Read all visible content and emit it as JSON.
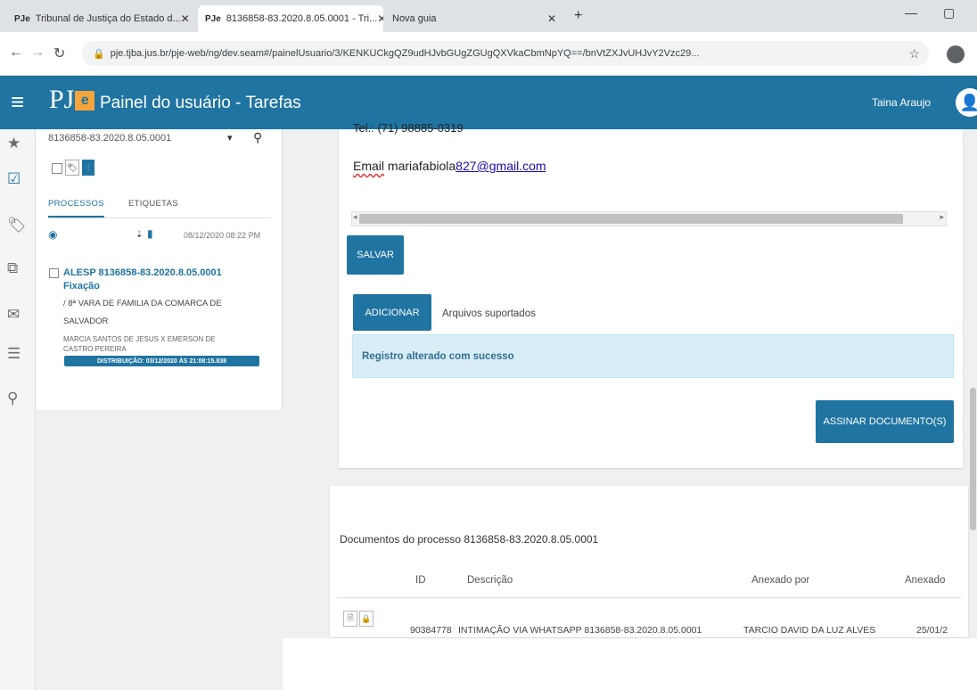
{
  "browser": {
    "tabs": [
      {
        "favicon": "PJe",
        "label": "Tribunal de Justiça do Estado d...",
        "active": false
      },
      {
        "favicon": "PJe",
        "label": "8136858-83.2020.8.05.0001 - Tri...",
        "active": true
      },
      {
        "favicon": "",
        "label": "Nova guia",
        "active": false
      }
    ],
    "url": "pje.tjba.jus.br/pje-web/ng/dev.seam#/painelUsuario/3/KENKUCkgQZ9udHJvbGUgZGUgQXVkaCbmNpYQ==/bnVtZXJvUHJvY2Vzc29...",
    "new_tab_glyph": "+"
  },
  "app": {
    "logo_text": "PJ",
    "logo_e": "e",
    "title": "Painel do usuário - Tarefas",
    "user_name": "Taina Araujo"
  },
  "sidebar": {
    "search_value": "8136858-83.2020.8.05.0001",
    "tabs": [
      "PROCESSOS",
      "ETIQUETAS"
    ],
    "list_date": "08/12/2020 08:22 PM",
    "process": {
      "number": "ALESP 8136858-83.2020.8.05.0001",
      "type": "Fixação",
      "org_line1": "/ 8ª VARA DE FAMILIA DA COMARCA DE",
      "org_line2": "SALVADOR",
      "parts_line1": "MARCIA SANTOS DE JESUS X EMERSON DE",
      "parts_line2": "CASTRO PEREIRA",
      "distribution": "DISTRIBUIÇÃO: 03/12/2020 ÀS 21:08:15.838"
    }
  },
  "editor": {
    "tel_line": "Tel.: (71) 98885-0319",
    "email_label": "Email",
    "email_prefix": " mariafabiola",
    "email_link": "827@gmail.com"
  },
  "actions": {
    "salvar": "SALVAR",
    "adicionar": "ADICIONAR",
    "arquivos": "Arquivos suportados",
    "alert": "Registro alterado com sucesso",
    "assinar": "ASSINAR DOCUMENTO(S)"
  },
  "documents": {
    "title": "Documentos do processo 8136858-83.2020.8.05.0001",
    "columns": [
      "ID",
      "Descrição",
      "Anexado por",
      "Anexado"
    ],
    "rows": [
      {
        "id": "90384778",
        "descricao": "INTIMAÇÃO VIA WHATSAPP 8136858-83.2020.8.05.0001",
        "anexado_por": "TARCIO DAVID DA LUZ ALVES",
        "anexado_em": "25/01/2"
      }
    ]
  },
  "colors": {
    "brand": "#1f74a1",
    "accent_logo": "#f6a43a",
    "alert_bg": "#d9edf7"
  }
}
